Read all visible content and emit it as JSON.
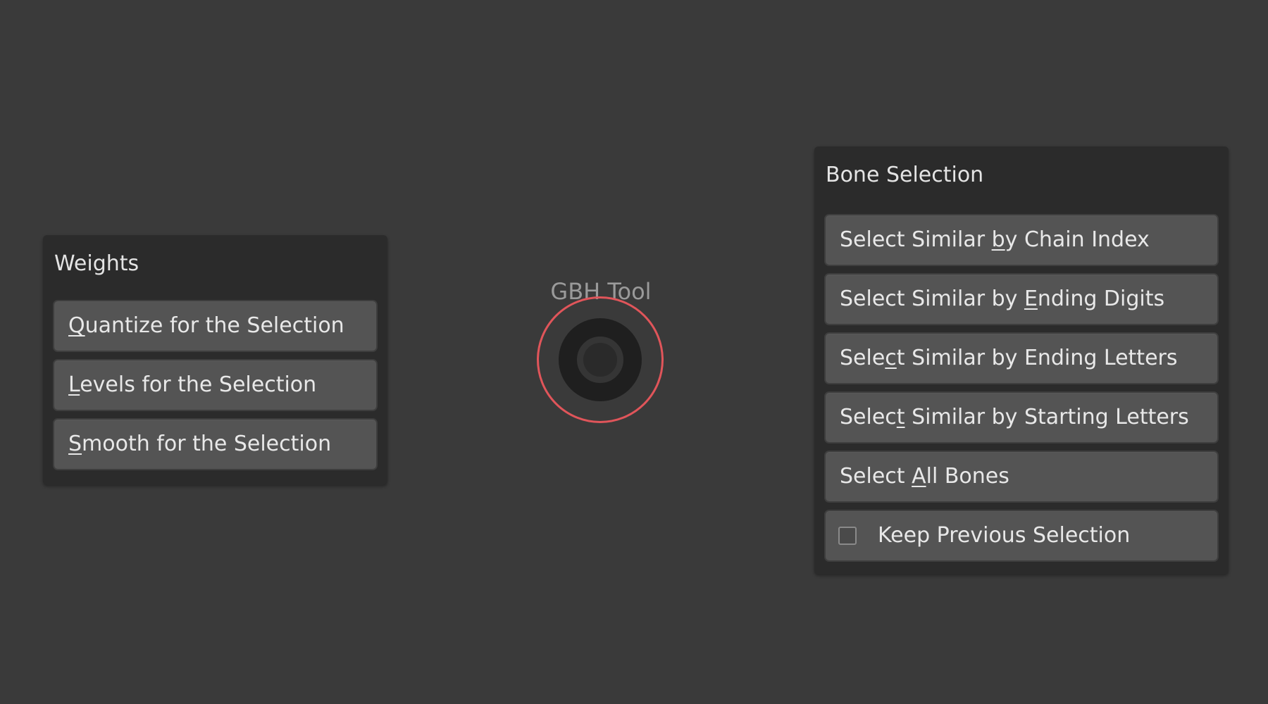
{
  "weights_panel": {
    "title": "Weights",
    "buttons": [
      {
        "pre": "",
        "u": "Q",
        "post": "uantize for the Selection"
      },
      {
        "pre": "",
        "u": "L",
        "post": "evels for the Selection"
      },
      {
        "pre": "",
        "u": "S",
        "post": "mooth for the Selection"
      }
    ]
  },
  "pie_menu": {
    "title": "GBH Tool"
  },
  "bones_panel": {
    "title": "Bone Selection",
    "buttons": [
      {
        "pre": "Select Similar ",
        "u": "b",
        "post": "y Chain Index"
      },
      {
        "pre": "Select Similar by ",
        "u": "E",
        "post": "nding Digits"
      },
      {
        "pre": "Sele",
        "u": "c",
        "post": "t Similar by Ending Letters"
      },
      {
        "pre": "Selec",
        "u": "t",
        "post": " Similar by Starting Letters"
      },
      {
        "pre": "Select ",
        "u": "A",
        "post": "ll Bones"
      }
    ],
    "checkbox": {
      "label": "Keep Previous Selection",
      "checked": false
    }
  },
  "colors": {
    "background": "#3a3a3a",
    "panel": "#2b2b2b",
    "button": "#545454",
    "pie_ring": "#e0555a"
  }
}
